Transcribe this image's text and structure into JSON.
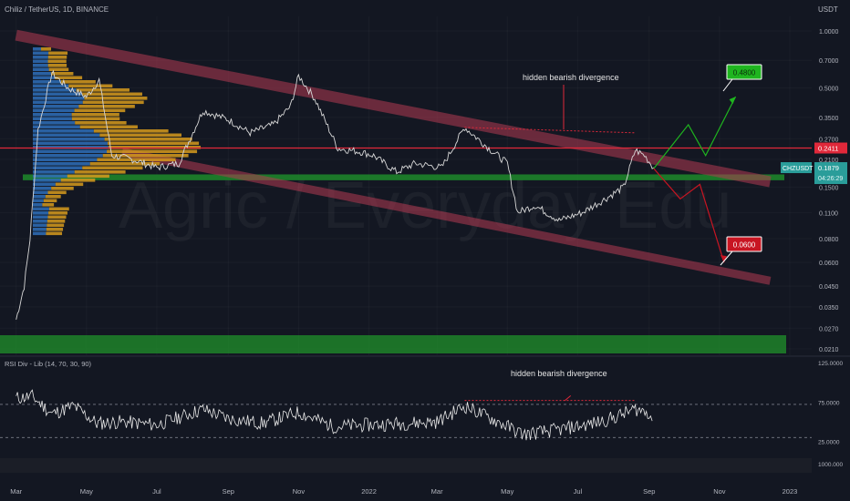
{
  "header": {
    "symbol_line": "Chiliz / TetherUS, 1D, BINANCE",
    "currency": "USDT"
  },
  "watermark": "Agric / Everyday Edu",
  "colors": {
    "background": "#131722",
    "channel": "#b23a52",
    "support_zone": "#1f8a2a",
    "resistance_line": "#e0283a",
    "price_line": "#d8d8d8",
    "vp_blue": "#2f6fb8",
    "vp_orange": "#d69a1c",
    "target_up": "#1fb51f",
    "target_down": "#c81522",
    "current_tag": "#2a9d9a"
  },
  "chart_data": [
    {
      "type": "line",
      "title": "Chiliz / TetherUS, 1D, BINANCE",
      "y_scale": "log",
      "y_unit": "USDT",
      "y_tick_labels": [
        "1.0000",
        "0.7000",
        "0.5000",
        "0.3500",
        "0.2700",
        "0.2100",
        "0.1500",
        "0.1100",
        "0.0800",
        "0.0600",
        "0.0450",
        "0.0350",
        "0.0270",
        "0.0210"
      ],
      "x_tick_labels": [
        "Mar",
        "May",
        "Jul",
        "Sep",
        "Nov",
        "2022",
        "Mar",
        "May",
        "Jul",
        "Sep",
        "Nov",
        "2023"
      ],
      "price_path": {
        "dates": [
          "2021-03-01",
          "2021-03-08",
          "2021-03-13",
          "2021-03-20",
          "2021-04-01",
          "2021-04-15",
          "2021-05-01",
          "2021-05-12",
          "2021-05-23",
          "2021-06-10",
          "2021-07-01",
          "2021-07-20",
          "2021-08-10",
          "2021-09-01",
          "2021-09-20",
          "2021-10-10",
          "2021-10-25",
          "2021-11-01",
          "2021-11-15",
          "2021-12-05",
          "2021-12-25",
          "2022-01-05",
          "2022-01-25",
          "2022-02-10",
          "2022-03-05",
          "2022-03-25",
          "2022-04-15",
          "2022-05-01",
          "2022-05-10",
          "2022-05-25",
          "2022-06-15",
          "2022-07-05",
          "2022-07-25",
          "2022-08-10",
          "2022-08-20",
          "2022-08-28",
          "2022-09-05"
        ],
        "close": [
          0.03,
          0.045,
          0.08,
          0.3,
          0.6,
          0.5,
          0.45,
          0.55,
          0.22,
          0.21,
          0.19,
          0.2,
          0.38,
          0.34,
          0.29,
          0.32,
          0.4,
          0.58,
          0.44,
          0.24,
          0.23,
          0.22,
          0.18,
          0.2,
          0.19,
          0.31,
          0.24,
          0.2,
          0.11,
          0.12,
          0.1,
          0.11,
          0.13,
          0.15,
          0.235,
          0.22,
          0.19
        ]
      },
      "levels": [
        {
          "label": "0.2411",
          "value": 0.2411,
          "kind": "resistance"
        },
        {
          "label": "CHZUSDT",
          "value": 0.1879,
          "kind": "current",
          "price": "0.1879",
          "countdown": "04:26:29"
        }
      ],
      "support_zone": {
        "low": 0.163,
        "high": 0.175
      },
      "lower_zone": {
        "low": 0.0205,
        "high": 0.0245
      },
      "channel": {
        "upper": [
          {
            "date": "2021-03-01",
            "value": 0.95
          },
          {
            "date": "2022-12-15",
            "value": 0.16
          }
        ],
        "lower": [
          {
            "date": "2021-06-01",
            "value": 0.23
          },
          {
            "date": "2022-12-15",
            "value": 0.048
          }
        ]
      },
      "projections": {
        "bullish": [
          {
            "date": "2022-09-05",
            "value": 0.188
          },
          {
            "date": "2022-10-05",
            "value": 0.32
          },
          {
            "date": "2022-10-20",
            "value": 0.22
          },
          {
            "date": "2022-11-15",
            "value": 0.45
          }
        ],
        "bearish": [
          {
            "date": "2022-09-05",
            "value": 0.188
          },
          {
            "date": "2022-09-28",
            "value": 0.13
          },
          {
            "date": "2022-10-15",
            "value": 0.155
          },
          {
            "date": "2022-11-05",
            "value": 0.06
          }
        ]
      },
      "targets": [
        {
          "label": "0.4800",
          "value": 0.48,
          "direction": "up"
        },
        {
          "label": "0.0600",
          "value": 0.06,
          "direction": "down"
        }
      ],
      "annotation": "hidden bearish divergence",
      "divergence_line": [
        {
          "date": "2022-03-25",
          "value": 0.31
        },
        {
          "date": "2022-08-20",
          "value": 0.29
        }
      ]
    },
    {
      "type": "line",
      "title": "RSI Div - Lib (14, 70, 30, 90)",
      "y_tick_labels": [
        "125.0000",
        "75.0000",
        "25.0000",
        "1000.000"
      ],
      "guides": [
        72,
        30
      ],
      "ylim": [
        5,
        125
      ],
      "annotation": "hidden bearish divergence",
      "rsi": {
        "dates": [
          "2021-03-01",
          "2021-03-15",
          "2021-04-01",
          "2021-04-20",
          "2021-05-10",
          "2021-06-01",
          "2021-07-01",
          "2021-08-10",
          "2021-09-01",
          "2021-10-01",
          "2021-11-01",
          "2021-12-01",
          "2022-01-01",
          "2022-02-01",
          "2022-03-01",
          "2022-03-25",
          "2022-04-20",
          "2022-05-15",
          "2022-06-15",
          "2022-07-15",
          "2022-08-01",
          "2022-08-20",
          "2022-09-01",
          "2022-09-05"
        ],
        "values": [
          80,
          82,
          60,
          70,
          48,
          50,
          46,
          66,
          54,
          48,
          62,
          44,
          46,
          48,
          50,
          70,
          52,
          34,
          40,
          48,
          55,
          66,
          62,
          48
        ]
      }
    }
  ]
}
